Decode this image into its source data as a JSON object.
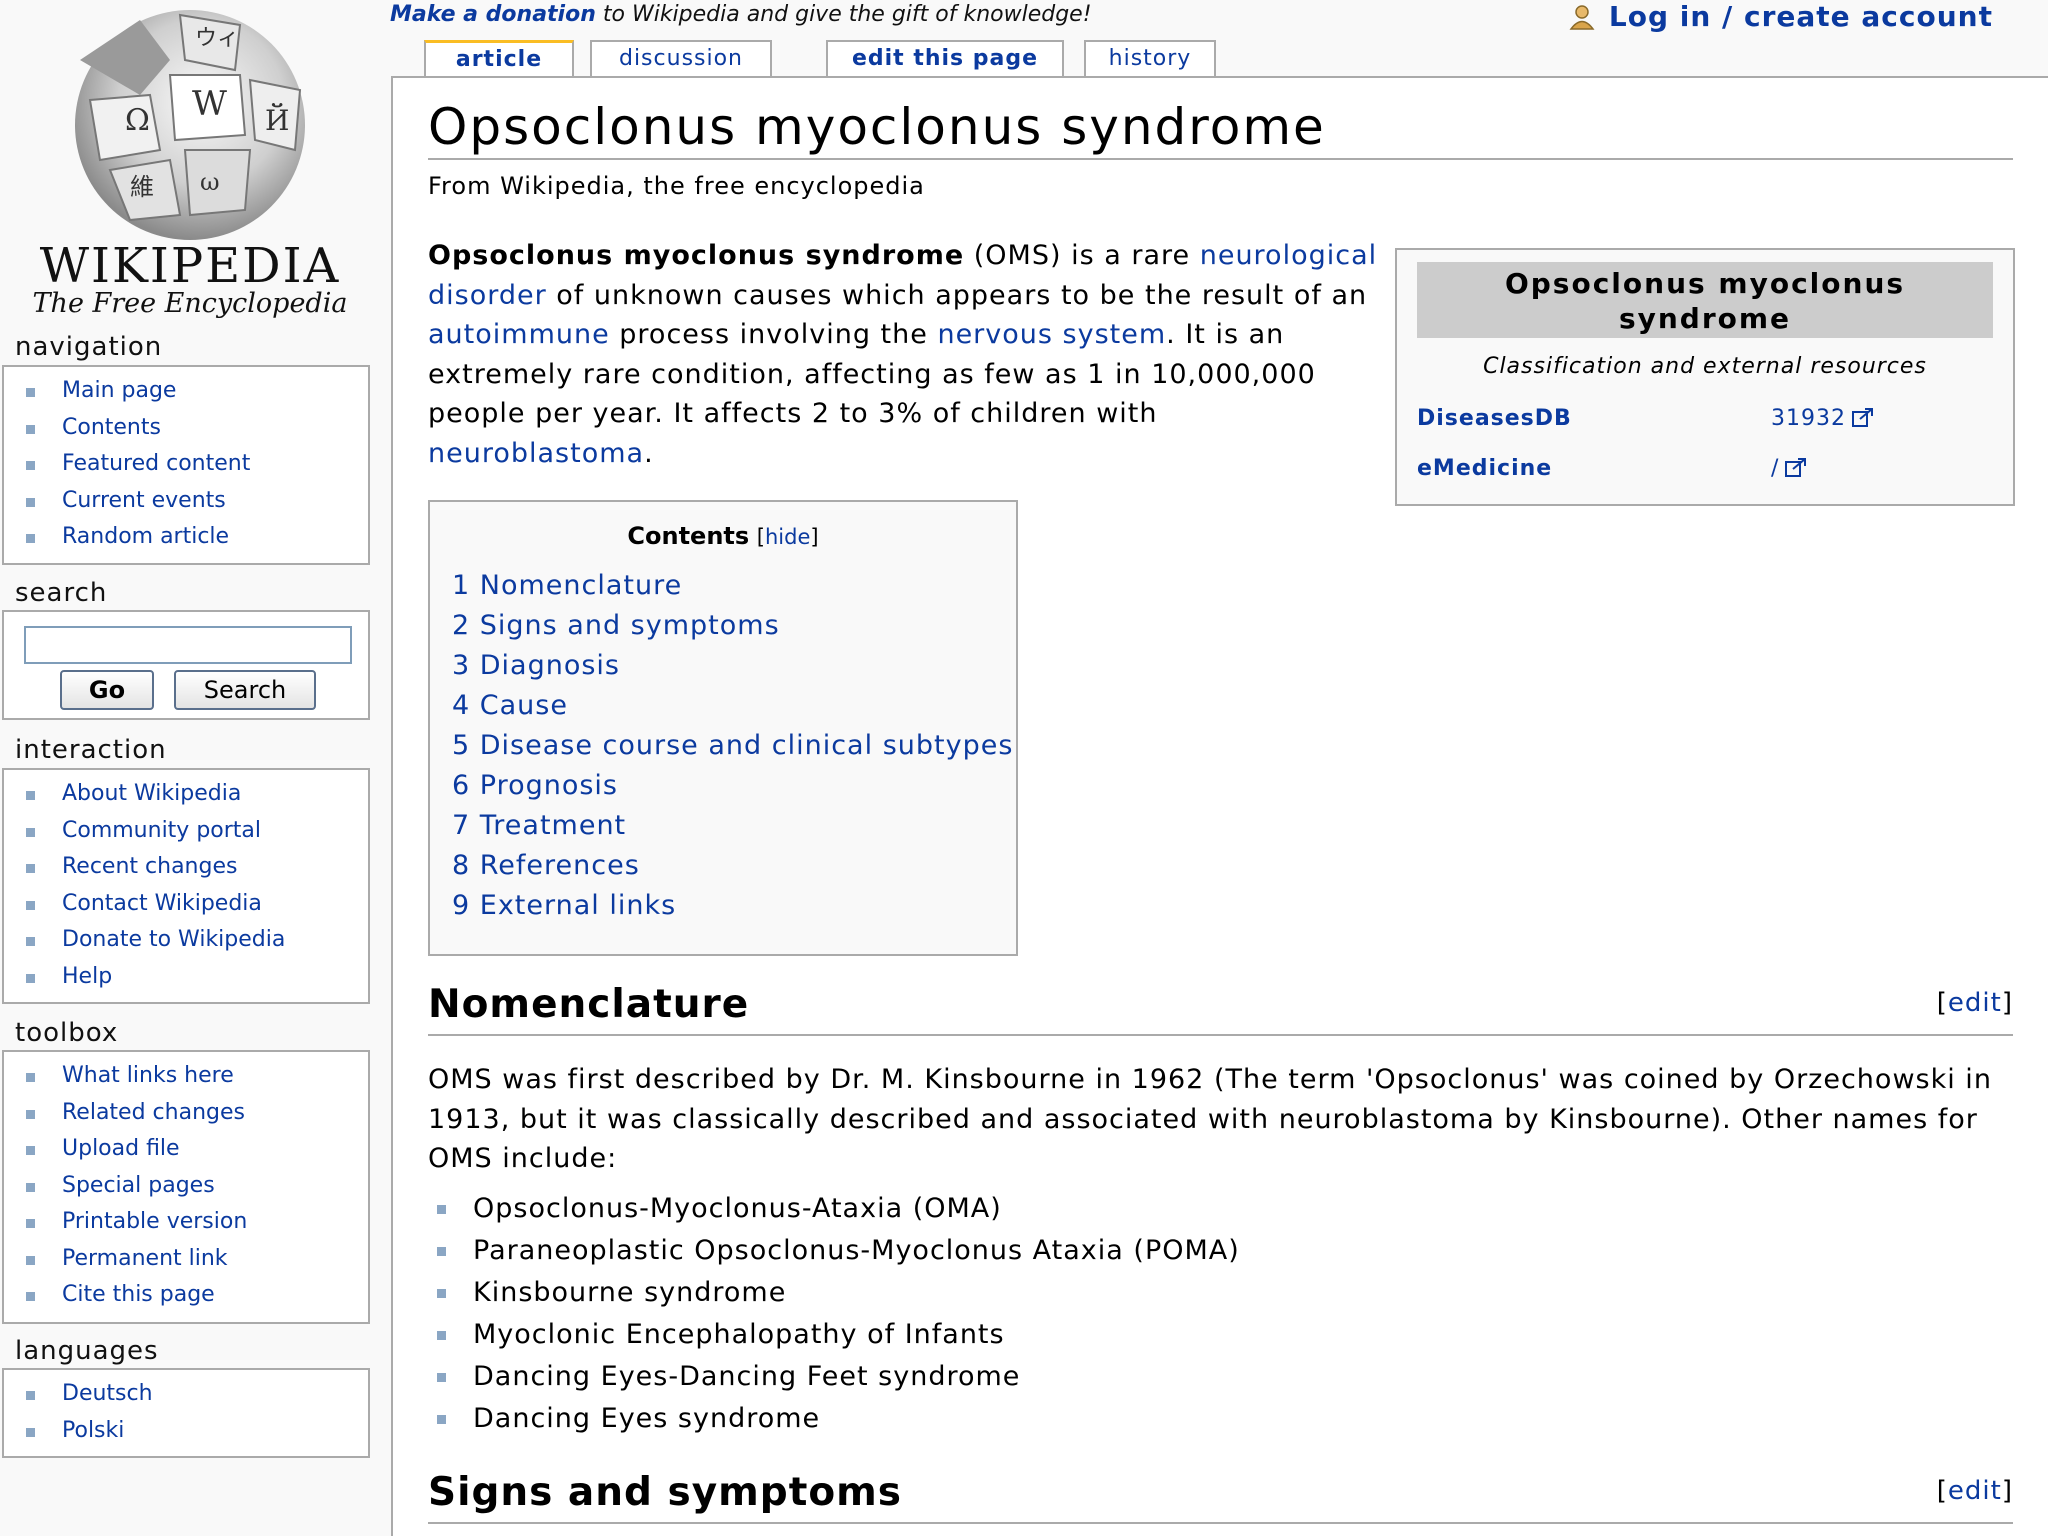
{
  "logo": {
    "wordmark": "WIKIPEDIA",
    "tagline": "The Free Encyclopedia"
  },
  "sitenotice": {
    "donate_link": "Make a donation",
    "text": " to Wikipedia and give the gift of knowledge!"
  },
  "personal": {
    "login_label": "Log in / create account",
    "icon": "user-icon"
  },
  "tabs": [
    {
      "label": "article",
      "selected": true
    },
    {
      "label": "discussion",
      "selected": false
    },
    {
      "label": "edit this page",
      "selected": false
    },
    {
      "label": "history",
      "selected": false
    }
  ],
  "sidebar": {
    "navigation": {
      "title": "navigation",
      "items": [
        "Main page",
        "Contents",
        "Featured content",
        "Current events",
        "Random article"
      ]
    },
    "search": {
      "title": "search",
      "value": "",
      "go_label": "Go",
      "search_label": "Search"
    },
    "interaction": {
      "title": "interaction",
      "items": [
        "About Wikipedia",
        "Community portal",
        "Recent changes",
        "Contact Wikipedia",
        "Donate to Wikipedia",
        "Help"
      ]
    },
    "toolbox": {
      "title": "toolbox",
      "items": [
        "What links here",
        "Related changes",
        "Upload file",
        "Special pages",
        "Printable version",
        "Permanent link",
        "Cite this page"
      ]
    },
    "languages": {
      "title": "languages",
      "items": [
        "Deutsch",
        "Polski"
      ]
    }
  },
  "article": {
    "title": "Opsoclonus myoclonus syndrome",
    "site_sub": "From Wikipedia, the free encyclopedia",
    "lead": {
      "bold": "Opsoclonus myoclonus syndrome",
      "t1": " (OMS) is a rare ",
      "link1": "neurological disorder",
      "t2": " of unknown causes which appears to be the result of an ",
      "link2": "autoimmune",
      "t3": " process involving the ",
      "link3": "nervous system",
      "t4": ". It is an extremely rare condition, affecting as few as 1 in 10,000,000 people per year. It affects 2 to 3% of children with ",
      "link4": "neuroblastoma",
      "t5": "."
    },
    "infobox": {
      "title": "Opsoclonus myoclonus syndrome",
      "subtitle": "Classification and external resources",
      "rows": [
        {
          "label": "DiseasesDB",
          "value": "31932"
        },
        {
          "label": "eMedicine",
          "value": "/"
        }
      ]
    },
    "toc": {
      "title": "Contents",
      "hide_label": "hide",
      "items": [
        "1 Nomenclature",
        "2 Signs and symptoms",
        "3 Diagnosis",
        "4 Cause",
        "5 Disease course and clinical subtypes",
        "6 Prognosis",
        "7 Treatment",
        "8 References",
        "9 External links"
      ]
    },
    "sections": [
      {
        "heading": "Nomenclature",
        "edit_label": "edit",
        "paragraph": "OMS was first described by Dr. M. Kinsbourne in 1962 (The term 'Opsoclonus' was coined by Orzechowski in 1913, but it was classically described and associated with neuroblastoma by Kinsbourne). Other names for OMS include:",
        "list": [
          "Opsoclonus-Myoclonus-Ataxia (OMA)",
          "Paraneoplastic Opsoclonus-Myoclonus Ataxia (POMA)",
          "Kinsbourne syndrome",
          "Myoclonic Encephalopathy of Infants",
          "Dancing Eyes-Dancing Feet syndrome",
          "Dancing Eyes syndrome"
        ]
      },
      {
        "heading": "Signs and symptoms",
        "edit_label": "edit"
      }
    ]
  }
}
